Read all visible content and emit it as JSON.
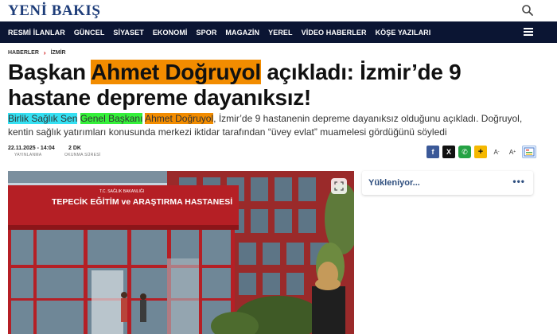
{
  "site": {
    "logo": "YENİ BAKIŞ"
  },
  "nav": {
    "items": [
      "RESMİ İLANLAR",
      "GÜNCEL",
      "SİYASET",
      "EKONOMİ",
      "SPOR",
      "MAGAZİN",
      "YEREL",
      "VİDEO HABERLER",
      "KÖŞE YAZILARI"
    ]
  },
  "breadcrumb": {
    "home": "HABERLER",
    "separator": "›",
    "current": "İZMİR"
  },
  "article": {
    "headline_pre": "Başkan ",
    "headline_hl": "Ahmet Doğruyol",
    "headline_post": " açıkladı: İzmir’de 9 hastane depreme dayanıksız!",
    "summary_hl1": "Birlik Sağlık Sen",
    "summary_sp1": " ",
    "summary_hl2": "Genel Başkanı",
    "summary_sp2": " ",
    "summary_hl3": "Ahmet Doğruyol",
    "summary_rest": ", İzmir’de 9 hastanenin depreme dayanıksız olduğunu açıkladı. Doğruyol, kentin sağlık yatırımları konusunda merkezi iktidar tarafından “üvey evlat” muamelesi gördüğünü söyledi",
    "published_date": "22.11.2025 - 14:04",
    "published_label": "YAYINLANMA",
    "read_time": "2 DK",
    "read_label": "OKUNMA SÜRESİ"
  },
  "share": {
    "facebook": "f",
    "x": "X",
    "whatsapp": "✆",
    "more": "+",
    "font_down": "A",
    "font_up": "A"
  },
  "image": {
    "sign_top": "T.C. SAĞLIK BAKANLIĞI",
    "sign_main": "TEPECİK EĞİTİM ve ARAŞTIRMA HASTANESİ"
  },
  "sidebar": {
    "loading": "Yükleniyor...",
    "more": "•••"
  },
  "colors": {
    "nav_bg": "#0b1533",
    "logo": "#1f3e7a",
    "highlight_orange": "#f28c00",
    "highlight_cyan": "#35e0f2",
    "highlight_green": "#35f03a"
  }
}
